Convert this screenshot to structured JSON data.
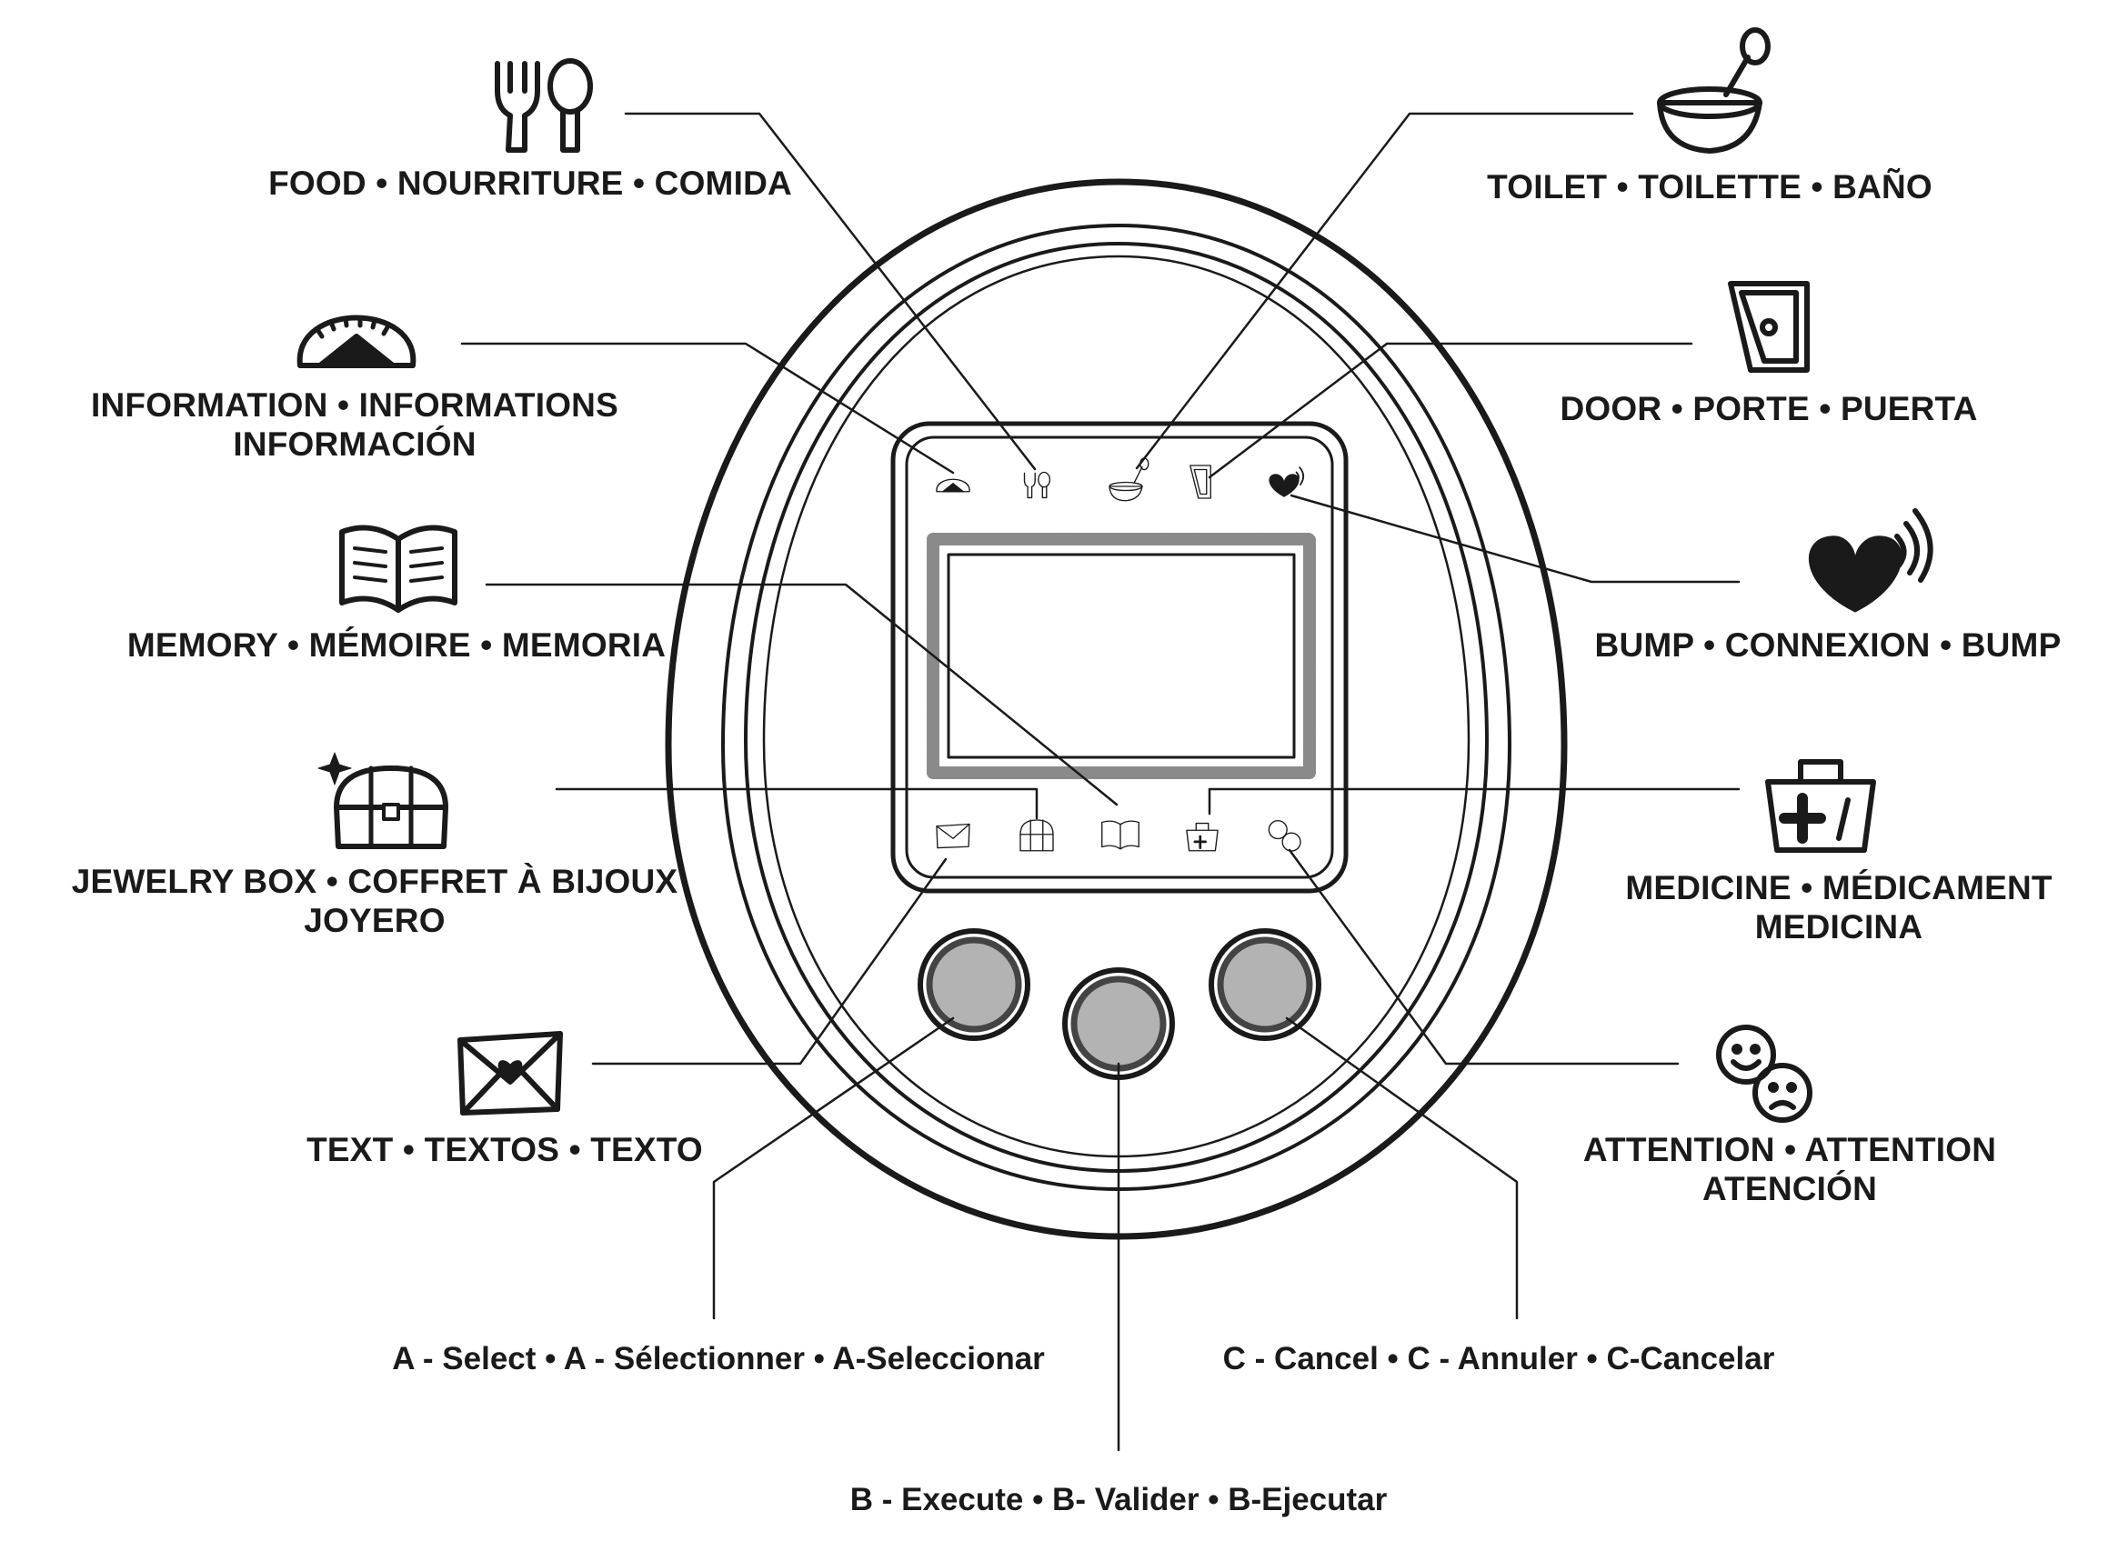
{
  "labels": {
    "food": "FOOD • NOURRITURE • COMIDA",
    "information_1": "INFORMATION • INFORMATIONS",
    "information_2": "INFORMACIÓN",
    "memory": "MEMORY • MÉMOIRE • MEMORIA",
    "jewelry_1": "JEWELRY BOX • COFFRET À BIJOUX",
    "jewelry_2": "JOYERO",
    "text": "TEXT • TEXTOS • TEXTO",
    "toilet": "TOILET • TOILETTE • BAÑO",
    "door": "DOOR • PORTE • PUERTA",
    "bump": "BUMP • CONNEXION • BUMP",
    "medicine_1": "MEDICINE • MÉDICAMENT",
    "medicine_2": "MEDICINA",
    "attention_1": "ATTENTION • ATTENTION",
    "attention_2": "ATENCIÓN"
  },
  "buttons": {
    "a": "A - Select • A - Sélectionner • A-Seleccionar",
    "b": "B - Execute • B- Valider • B-Ejecutar",
    "c": "C - Cancel • C - Annuler • C-Cancelar"
  },
  "colors": {
    "line": "#1a1a1a",
    "button_fill": "#b3b3b3",
    "button_ring": "#444444",
    "screen_border": "#8a8a8a"
  },
  "icons": [
    "fork-spoon-icon",
    "scale-icon",
    "book-icon",
    "treasure-chest-icon",
    "envelope-icon",
    "toilet-icon",
    "door-icon",
    "heart-signal-icon",
    "medicine-bag-icon",
    "faces-icon"
  ]
}
